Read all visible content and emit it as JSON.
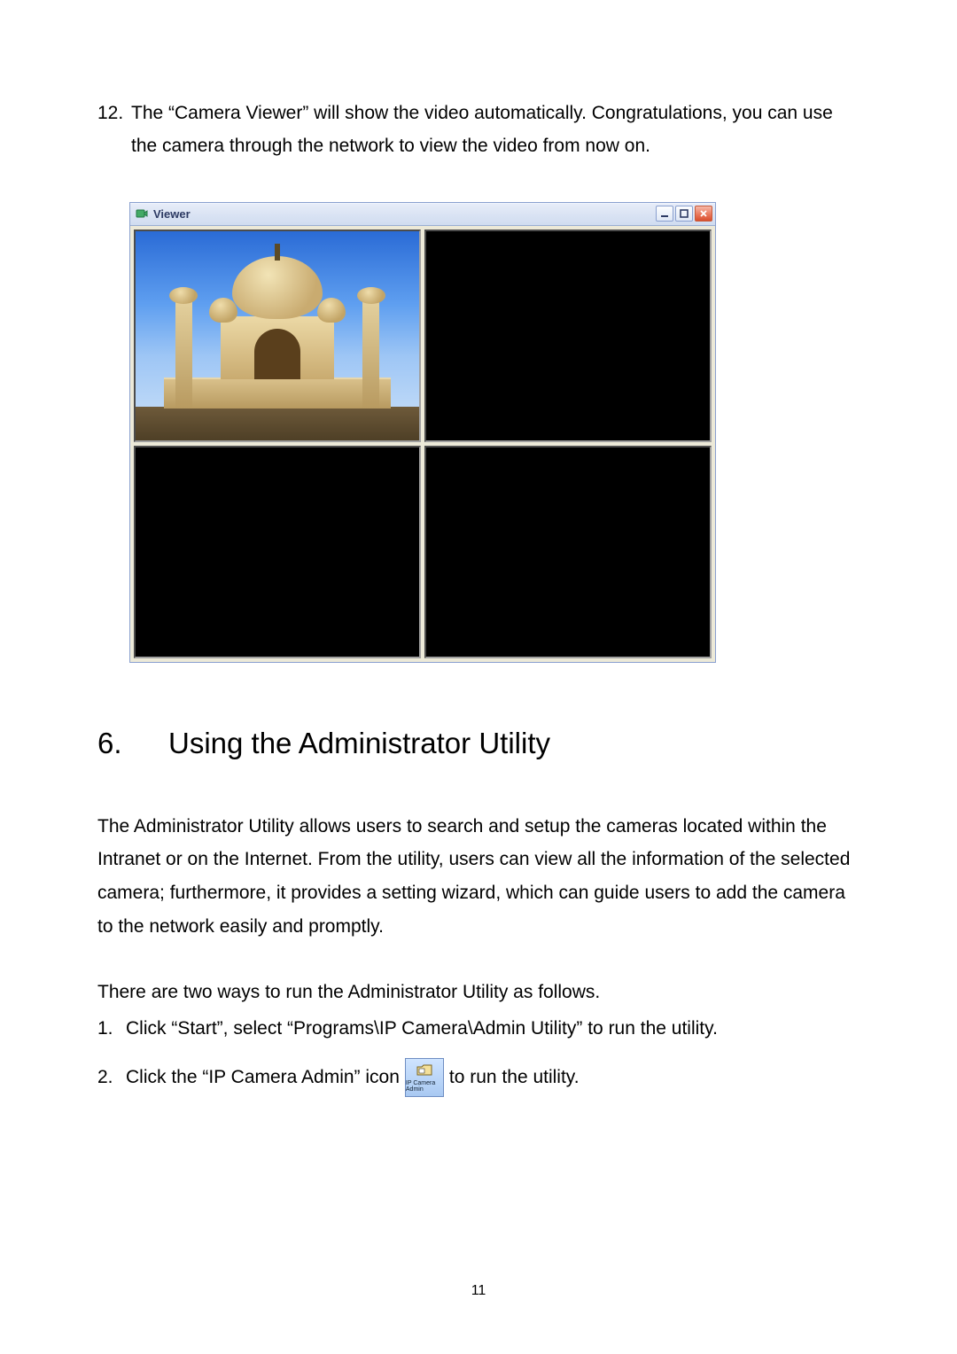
{
  "step12": {
    "number": "12.",
    "text": "The “Camera Viewer” will show the video automatically. Congratulations, you can use the camera through the network to view the video from now on."
  },
  "viewer": {
    "title": "Viewer",
    "buttons": {
      "min": "minimize",
      "max": "maximize",
      "close": "close"
    }
  },
  "section": {
    "number": "6.",
    "title": "Using the Administrator Utility"
  },
  "para1": "The Administrator Utility allows users to search and setup the cameras located within the Intranet or on the Internet. From the utility, users can view all the information of the selected camera; furthermore, it provides a setting wizard, which can guide users to add the camera to the network easily and promptly.",
  "para2": "There are two ways to run the Administrator Utility as follows.",
  "list": {
    "item1": {
      "num": "1.",
      "text": "Click “Start”, select “Programs\\IP Camera\\Admin Utility” to run the utility."
    },
    "item2": {
      "num": "2.",
      "pre": "Click the “IP Camera Admin” icon",
      "post": " to run the utility.",
      "iconLabel": "IP Camera Admin"
    }
  },
  "pageNumber": "11"
}
